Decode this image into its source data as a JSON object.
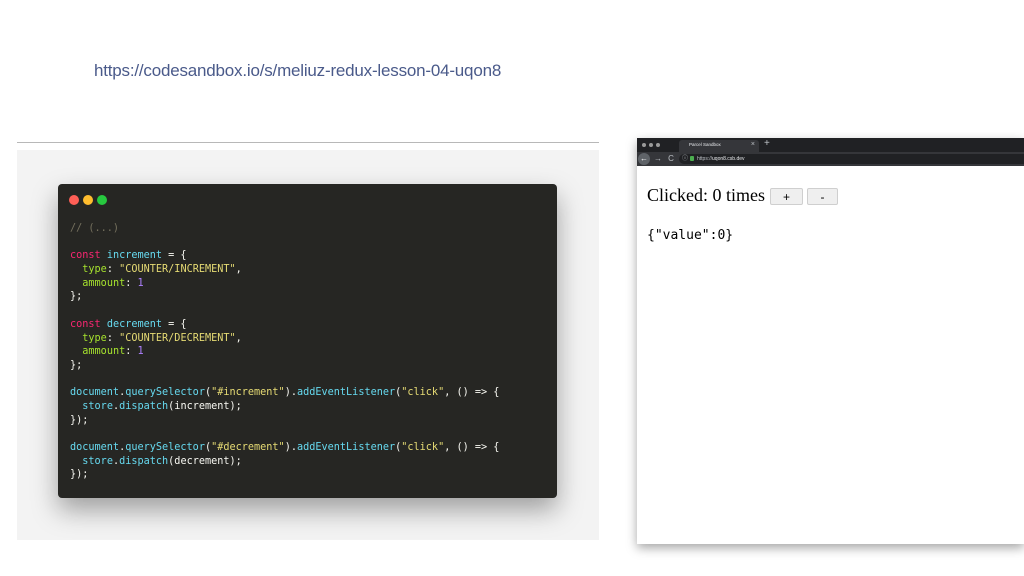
{
  "slide": {
    "link_text": "https://codesandbox.io/s/meliuz-redux-lesson-04-uqon8"
  },
  "code_window": {
    "lines": [
      [
        {
          "t": "// (...)",
          "k": "comment"
        }
      ],
      [],
      [
        {
          "t": "const",
          "k": "keyword"
        },
        {
          "t": " "
        },
        {
          "t": "increment",
          "k": "ident"
        },
        {
          "t": " = {"
        }
      ],
      [
        {
          "t": "  "
        },
        {
          "t": "type",
          "k": "prop"
        },
        {
          "t": ": "
        },
        {
          "t": "\"COUNTER/INCREMENT\"",
          "k": "string"
        },
        {
          "t": ","
        }
      ],
      [
        {
          "t": "  "
        },
        {
          "t": "ammount",
          "k": "prop"
        },
        {
          "t": ": "
        },
        {
          "t": "1",
          "k": "number"
        }
      ],
      [
        {
          "t": "};"
        }
      ],
      [],
      [
        {
          "t": "const",
          "k": "keyword"
        },
        {
          "t": " "
        },
        {
          "t": "decrement",
          "k": "ident"
        },
        {
          "t": " = {"
        }
      ],
      [
        {
          "t": "  "
        },
        {
          "t": "type",
          "k": "prop"
        },
        {
          "t": ": "
        },
        {
          "t": "\"COUNTER/DECREMENT\"",
          "k": "string"
        },
        {
          "t": ","
        }
      ],
      [
        {
          "t": "  "
        },
        {
          "t": "ammount",
          "k": "prop"
        },
        {
          "t": ": "
        },
        {
          "t": "1",
          "k": "number"
        }
      ],
      [
        {
          "t": "};"
        }
      ],
      [],
      [
        {
          "t": "document",
          "k": "ident"
        },
        {
          "t": "."
        },
        {
          "t": "querySelector",
          "k": "ident"
        },
        {
          "t": "("
        },
        {
          "t": "\"#increment\"",
          "k": "string"
        },
        {
          "t": ")."
        },
        {
          "t": "addEventListener",
          "k": "ident"
        },
        {
          "t": "("
        },
        {
          "t": "\"click\"",
          "k": "string"
        },
        {
          "t": ", () => {"
        }
      ],
      [
        {
          "t": "  "
        },
        {
          "t": "store",
          "k": "ident"
        },
        {
          "t": "."
        },
        {
          "t": "dispatch",
          "k": "ident"
        },
        {
          "t": "(increment);"
        }
      ],
      [
        {
          "t": "});"
        }
      ],
      [],
      [
        {
          "t": "document",
          "k": "ident"
        },
        {
          "t": "."
        },
        {
          "t": "querySelector",
          "k": "ident"
        },
        {
          "t": "("
        },
        {
          "t": "\"#decrement\"",
          "k": "string"
        },
        {
          "t": ")."
        },
        {
          "t": "addEventListener",
          "k": "ident"
        },
        {
          "t": "("
        },
        {
          "t": "\"click\"",
          "k": "string"
        },
        {
          "t": ", () => {"
        }
      ],
      [
        {
          "t": "  "
        },
        {
          "t": "store",
          "k": "ident"
        },
        {
          "t": "."
        },
        {
          "t": "dispatch",
          "k": "ident"
        },
        {
          "t": "(decrement);"
        }
      ],
      [
        {
          "t": "});"
        }
      ]
    ]
  },
  "browser": {
    "tab_title": "Parcel Sandbox",
    "tab_close_glyph": "×",
    "new_tab_glyph": "+",
    "back_glyph": "←",
    "forward_glyph": "→",
    "reload_glyph": "C",
    "info_glyph": "ⓘ",
    "url_prefix": "https://",
    "url_host": "uqon8.csb.dev"
  },
  "page": {
    "clicked_text": "Clicked: 0 times",
    "increment_label": "+",
    "decrement_label": "-",
    "state_text": "{\"value\":0}"
  },
  "colors": {
    "link": "#4a5a8a",
    "code_bg": "#262623",
    "keyword": "#f92672",
    "identifier": "#66d9ef",
    "property": "#a6e22e",
    "string": "#e6db74",
    "number": "#ae81ff",
    "comment": "#75715e"
  }
}
